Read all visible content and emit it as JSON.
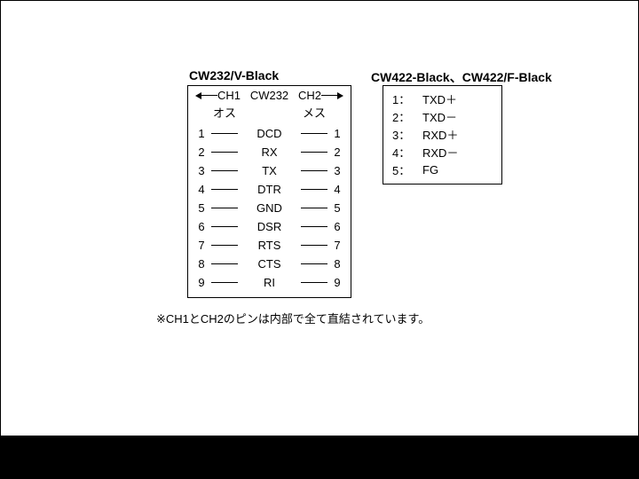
{
  "left": {
    "title": "CW232/V-Black",
    "ch1": "CH1",
    "center": "CW232",
    "ch2": "CH2",
    "male": "オス",
    "female": "メス",
    "pins": [
      {
        "l": "1",
        "name": "DCD",
        "r": "1"
      },
      {
        "l": "2",
        "name": "RX",
        "r": "2"
      },
      {
        "l": "3",
        "name": "TX",
        "r": "3"
      },
      {
        "l": "4",
        "name": "DTR",
        "r": "4"
      },
      {
        "l": "5",
        "name": "GND",
        "r": "5"
      },
      {
        "l": "6",
        "name": "DSR",
        "r": "6"
      },
      {
        "l": "7",
        "name": "RTS",
        "r": "7"
      },
      {
        "l": "8",
        "name": "CTS",
        "r": "8"
      },
      {
        "l": "9",
        "name": "RI",
        "r": "9"
      }
    ]
  },
  "right": {
    "title": "CW422-Black、CW422/F-Black",
    "rows": [
      {
        "k": "1：",
        "v": "TXD＋"
      },
      {
        "k": "2：",
        "v": "TXD－"
      },
      {
        "k": "3：",
        "v": "RXD＋"
      },
      {
        "k": "4：",
        "v": "RXD－"
      },
      {
        "k": "5：",
        "v": "FG"
      }
    ]
  },
  "footnote": "※CH1とCH2のピンは内部で全て直結されています。"
}
